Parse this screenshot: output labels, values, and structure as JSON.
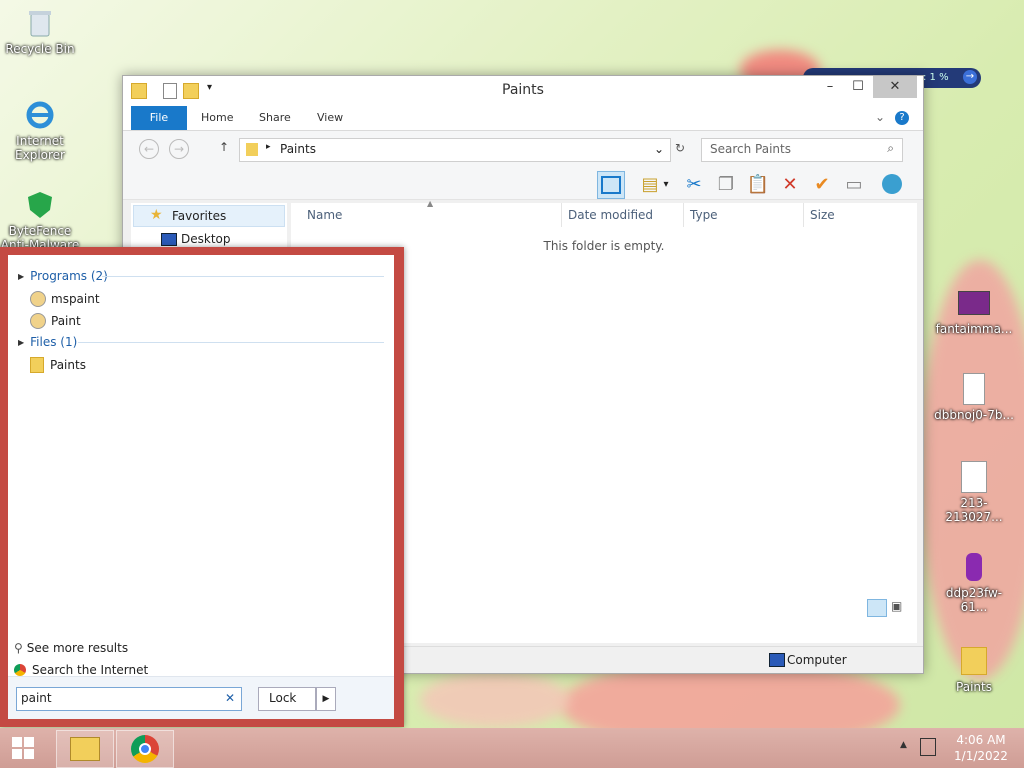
{
  "desktop": {
    "icons_left": [
      {
        "label": "Recycle Bin",
        "icon": "recycle-bin-icon"
      },
      {
        "label": "Internet\nExplorer",
        "icon": "internet-explorer-icon"
      },
      {
        "label": "ByteFence\nAnti-Malware",
        "icon": "bytefence-icon"
      }
    ],
    "icons_right": [
      {
        "label": "fantaimma...",
        "icon": "image-file-icon"
      },
      {
        "label": "dbbnoj0-7b...",
        "icon": "image-file-icon"
      },
      {
        "label": "213-213027...",
        "icon": "image-file-icon"
      },
      {
        "label": "ddp23fw-61...",
        "icon": "image-file-icon"
      },
      {
        "label": "Paints",
        "icon": "folder-icon"
      }
    ],
    "widget_text": ": 1 %"
  },
  "explorer": {
    "title": "Paints",
    "tabs": [
      "File",
      "Home",
      "Share",
      "View"
    ],
    "address_path": "Paints",
    "search_placeholder": "Search Paints",
    "nav": {
      "favorites": "Favorites",
      "desktop": "Desktop"
    },
    "columns": [
      "Name",
      "Date modified",
      "Type",
      "Size"
    ],
    "empty_message": "This folder is empty.",
    "status_location": "Computer"
  },
  "search_panel": {
    "programs_header": "Programs (2)",
    "programs": [
      "mspaint",
      "Paint"
    ],
    "files_header": "Files (1)",
    "files": [
      "Paints"
    ],
    "see_more": "See more results",
    "search_internet": "Search the Internet",
    "query": "paint",
    "lock_label": "Lock"
  },
  "taskbar": {
    "time": "4:06 AM",
    "date": "1/1/2022"
  },
  "colors": {
    "accent": "#1979ca",
    "panel_border": "#c44a43",
    "taskbar": "#d9a9a2"
  }
}
